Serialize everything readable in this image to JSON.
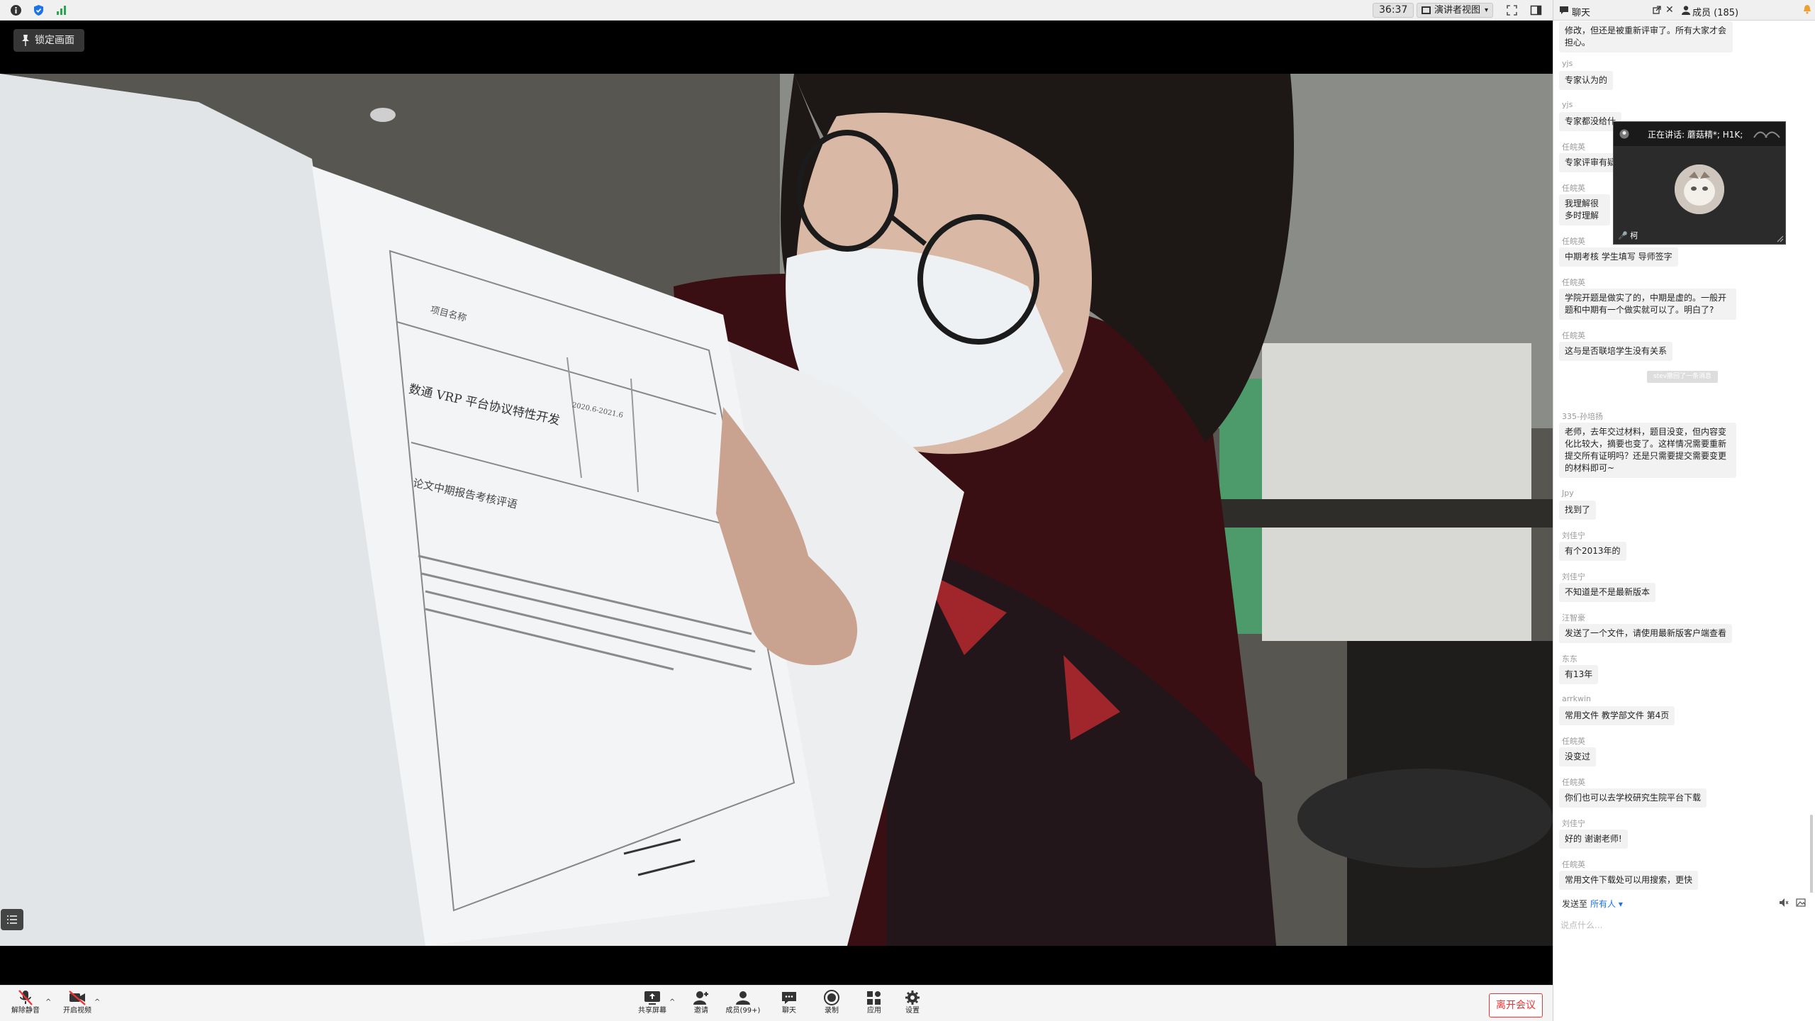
{
  "topbar": {
    "timer": "36:37",
    "view_label": "演讲者视图"
  },
  "video": {
    "lock_label": "锁定画面",
    "paper_title": "数通 VRP 平台协议特性开发",
    "paper_section": "论文中期报告考核评语",
    "paper_header": "项目名称",
    "paper_date": "2020.6-2021.6"
  },
  "toolbar": {
    "mute_label": "解除静音",
    "video_label": "开启视频",
    "share_label": "共享屏幕",
    "invite_label": "邀请",
    "members_label": "成员(99+)",
    "chat_label": "聊天",
    "record_label": "录制",
    "apps_label": "应用",
    "settings_label": "设置",
    "leave_label": "离开会议"
  },
  "panel": {
    "chat_title": "聊天",
    "members_title": "成员 (185)",
    "send_to_label": "发送至",
    "send_target": "所有人",
    "input_placeholder": "说点什么..."
  },
  "chat": {
    "messages": [
      {
        "sender": "",
        "text": "修改，但还是被重新评审了。所有大家才会担心。"
      },
      {
        "sender": "yjs",
        "text": "专家认为的"
      },
      {
        "sender": "yjs",
        "text": "专家都没给什"
      },
      {
        "sender": "任皖英",
        "text": "专家评审有疑"
      },
      {
        "sender": "任皖英",
        "text": "我理解很多时理解"
      },
      {
        "sender": "任皖英",
        "text": "中期考核 学生填写 导师签字"
      },
      {
        "sender": "任皖英",
        "text": "学院开题是做实了的，中期是虚的。一般开题和中期有一个做实就可以了。明白了?"
      },
      {
        "sender": "任皖英",
        "text": "这与是否联培学生没有关系"
      },
      {
        "sender": "335-孙培扬",
        "text": "老师，去年交过材料，题目没变，但内容变化比较大，摘要也变了。这样情况需要重新提交所有证明吗？还是只需要提交需要变更的材料即可~"
      },
      {
        "sender": "Jpy",
        "text": "找到了"
      },
      {
        "sender": "刘佳宁",
        "text": "有个2013年的"
      },
      {
        "sender": "刘佳宁",
        "text": "不知道是不是最新版本"
      },
      {
        "sender": "汪智豪",
        "text": "发送了一个文件，请使用最新版客户端查看"
      },
      {
        "sender": "东东",
        "text": "有13年"
      },
      {
        "sender": "arrkwin",
        "text": "常用文件  教学部文件  第4页"
      },
      {
        "sender": "任皖英",
        "text": "没变过"
      },
      {
        "sender": "任皖英",
        "text": "你们也可以去学校研究生院平台下载"
      },
      {
        "sender": "刘佳宁",
        "text": "好的 谢谢老师!"
      },
      {
        "sender": "任皖英",
        "text": "常用文件下载处可以用搜索，更快"
      }
    ],
    "recall_notice": "stev撤回了一条消息"
  },
  "speaker": {
    "talking_label": "正在讲话: 蘑菇精*; H1K;",
    "name": "柯"
  },
  "colors": {
    "accent": "#1a73e8",
    "leave": "#e33333"
  }
}
